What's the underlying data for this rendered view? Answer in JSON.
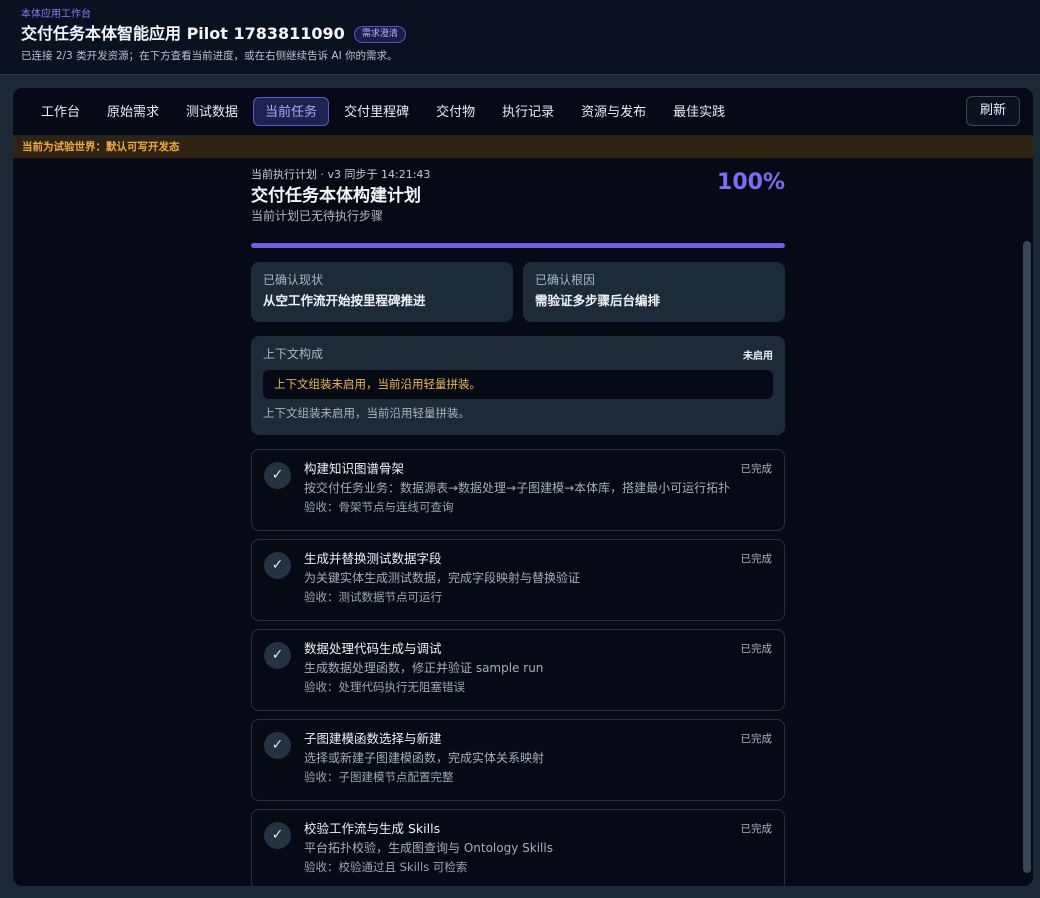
{
  "header": {
    "eyebrow": "本体应用工作台",
    "title": "交付任务本体智能应用 Pilot 1783811090",
    "badge": "需求澄清",
    "subtitle": "已连接 2/3 类开发资源；在下方查看当前进度，或在右侧继续告诉 AI 你的需求。"
  },
  "tabs": [
    {
      "label": "工作台"
    },
    {
      "label": "原始需求"
    },
    {
      "label": "测试数据"
    },
    {
      "label": "当前任务"
    },
    {
      "label": "交付里程碑"
    },
    {
      "label": "交付物"
    },
    {
      "label": "执行记录"
    },
    {
      "label": "资源与发布"
    },
    {
      "label": "最佳实践"
    }
  ],
  "active_tab": "当前任务",
  "refresh_label": "刷新",
  "notice": "当前为试验世界：默认可写开发态",
  "plan": {
    "meta": "当前执行计划 · v3   同步于 14:21:43",
    "title": "交付任务本体构建计划",
    "subtitle": "当前计划已无待执行步骤",
    "percent_label": "100%",
    "progress": 1.0
  },
  "facts": [
    {
      "label": "已确认现状",
      "value": "从空工作流开始按里程碑推进"
    },
    {
      "label": "已确认根因",
      "value": "需验证多步骤后台编排"
    }
  ],
  "context": {
    "title": "上下文构成",
    "status": "未启用",
    "warning": "上下文组装未启用，当前沿用轻量拼装。",
    "note": "上下文组装未启用，当前沿用轻量拼装。"
  },
  "steps": [
    {
      "title": "构建知识图谱骨架",
      "desc": "按交付任务业务：数据源表→数据处理→子图建模→本体库，搭建最小可运行拓扑",
      "accept": "验收：骨架节点与连线可查询",
      "status": "已完成"
    },
    {
      "title": "生成并替换测试数据字段",
      "desc": "为关键实体生成测试数据，完成字段映射与替换验证",
      "accept": "验收：测试数据节点可运行",
      "status": "已完成"
    },
    {
      "title": "数据处理代码生成与调试",
      "desc": "生成数据处理函数，修正并验证 sample run",
      "accept": "验收：处理代码执行无阻塞错误",
      "status": "已完成"
    },
    {
      "title": "子图建模函数选择与新建",
      "desc": "选择或新建子图建模函数，完成实体关系映射",
      "accept": "验收：子图建模节点配置完整",
      "status": "已完成"
    },
    {
      "title": "校验工作流与生成 Skills",
      "desc": "平台拓扑校验，生成图查询与 Ontology Skills",
      "accept": "验收：校验通过且 Skills 可检索",
      "status": "已完成"
    }
  ],
  "check_glyph": "✓"
}
